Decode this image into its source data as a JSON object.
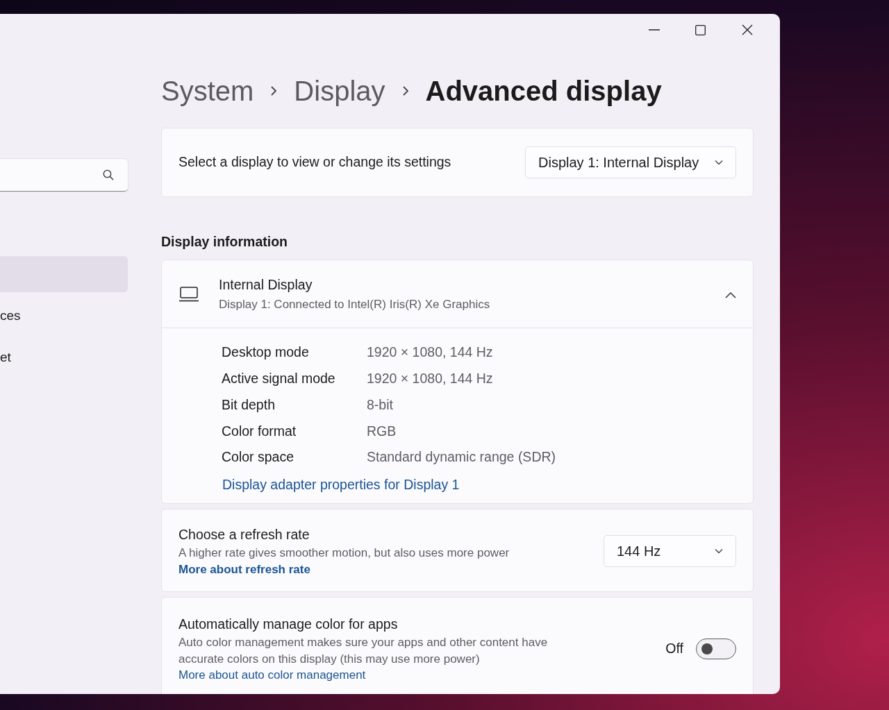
{
  "sidebar": {
    "items": [
      {
        "selected": true
      },
      {
        "label": "ces",
        "selected": false
      },
      {
        "label": "et",
        "selected": false
      }
    ]
  },
  "breadcrumb": [
    "System",
    "Display",
    "Advanced display"
  ],
  "display_select": {
    "label": "Select a display to view or change its settings",
    "value": "Display 1: Internal Display"
  },
  "section_title": "Display information",
  "display_info": {
    "name": "Internal Display",
    "subtitle": "Display 1: Connected to Intel(R) Iris(R) Xe Graphics",
    "expanded": true,
    "rows": [
      {
        "label": "Desktop mode",
        "value": "1920 × 1080, 144 Hz"
      },
      {
        "label": "Active signal mode",
        "value": "1920 × 1080, 144 Hz"
      },
      {
        "label": "Bit depth",
        "value": "8-bit"
      },
      {
        "label": "Color format",
        "value": "RGB"
      },
      {
        "label": "Color space",
        "value": "Standard dynamic range (SDR)"
      }
    ],
    "link": "Display adapter properties for Display 1"
  },
  "settings": [
    {
      "kind": "dropdown",
      "title": "Choose a refresh rate",
      "description": "A higher rate gives smoother motion, but also uses more power",
      "link": "More about refresh rate",
      "value": "144 Hz"
    },
    {
      "kind": "toggle",
      "title": "Automatically manage color for apps",
      "description": "Auto color management makes sure your apps and other content have accurate colors on this display (this may use more power)",
      "link": "More about auto color management",
      "state_label": "Off",
      "on": false
    }
  ]
}
